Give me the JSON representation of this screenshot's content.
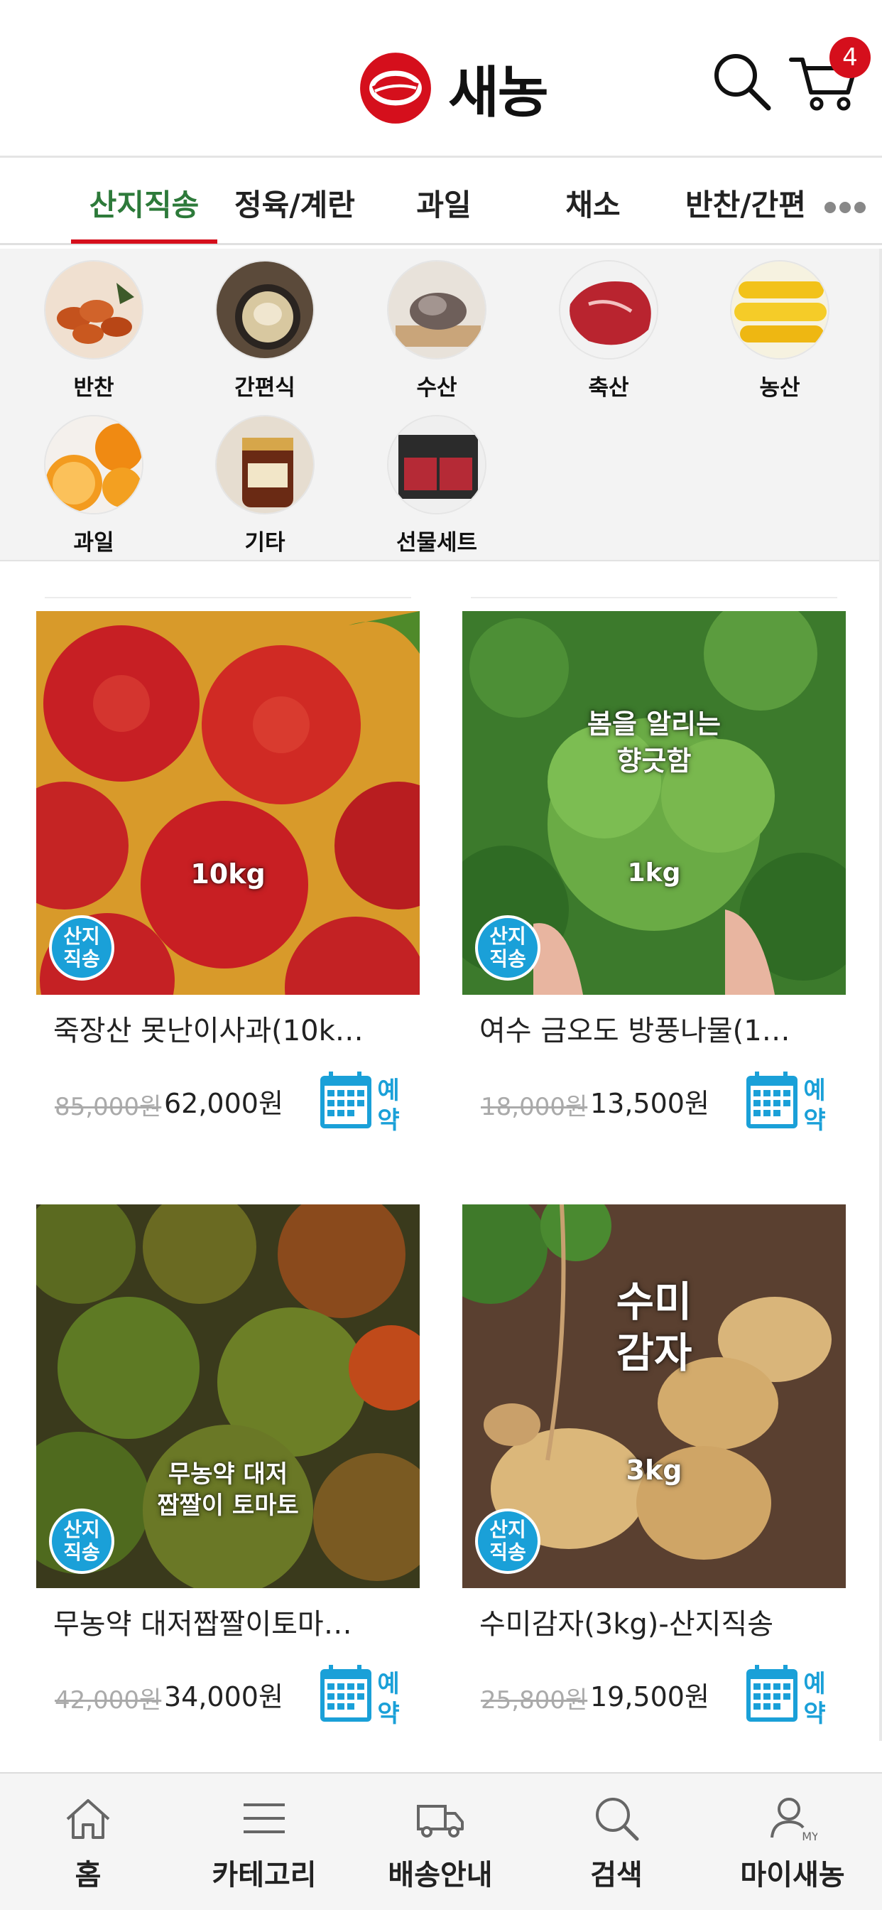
{
  "header": {
    "logo_text": "새농",
    "cart_count": "4",
    "brand_color": "#d50f1c"
  },
  "tabs": [
    {
      "label": "산지직송",
      "active": true
    },
    {
      "label": "정육/계란"
    },
    {
      "label": "과일"
    },
    {
      "label": "채소"
    },
    {
      "label": "반찬/간편"
    }
  ],
  "categories": [
    {
      "label": "반찬",
      "icon": "banchan-image"
    },
    {
      "label": "간편식",
      "icon": "simple-meal-image"
    },
    {
      "label": "수산",
      "icon": "seafood-image"
    },
    {
      "label": "축산",
      "icon": "meat-image"
    },
    {
      "label": "농산",
      "icon": "corn-image"
    },
    {
      "label": "과일",
      "icon": "orange-image"
    },
    {
      "label": "기타",
      "icon": "jar-image"
    },
    {
      "label": "선물세트",
      "icon": "gift-set-image"
    }
  ],
  "products": [
    {
      "name": "죽장산 못난이사과(10k…",
      "orig_price": "85,000원",
      "sale_price": "62,000원",
      "image_text": [
        "10kg"
      ],
      "badge": [
        "산지",
        "직송"
      ],
      "reserve": "예약"
    },
    {
      "name": "여수 금오도 방풍나물(1…",
      "orig_price": "18,000원",
      "sale_price": "13,500원",
      "image_text": [
        "봄을 알리는",
        "향긋함",
        "1kg"
      ],
      "badge": [
        "산지",
        "직송"
      ],
      "reserve": "예약"
    },
    {
      "name": "무농약 대저짭짤이토마…",
      "orig_price": "42,000원",
      "sale_price": "34,000원",
      "image_text": [
        "무농약 대저",
        "짭짤이 토마토"
      ],
      "badge": [
        "산지",
        "직송"
      ],
      "reserve": "예약"
    },
    {
      "name": "수미감자(3kg)-산지직송",
      "orig_price": "25,800원",
      "sale_price": "19,500원",
      "image_text": [
        "수미",
        "감자",
        "3kg"
      ],
      "badge": [
        "산지",
        "직송"
      ],
      "reserve": "예약"
    }
  ],
  "bottom_nav": [
    {
      "label": "홈",
      "icon": "home-icon"
    },
    {
      "label": "카테고리",
      "icon": "menu-icon"
    },
    {
      "label": "배송안내",
      "icon": "truck-icon"
    },
    {
      "label": "검색",
      "icon": "search-icon"
    },
    {
      "label": "마이새농",
      "icon": "user-icon",
      "icon_text": "MY"
    }
  ],
  "colors": {
    "active_tab": "#2d7a3a",
    "badge_blue": "#1aa0d8",
    "accent_red": "#d50f1c"
  }
}
